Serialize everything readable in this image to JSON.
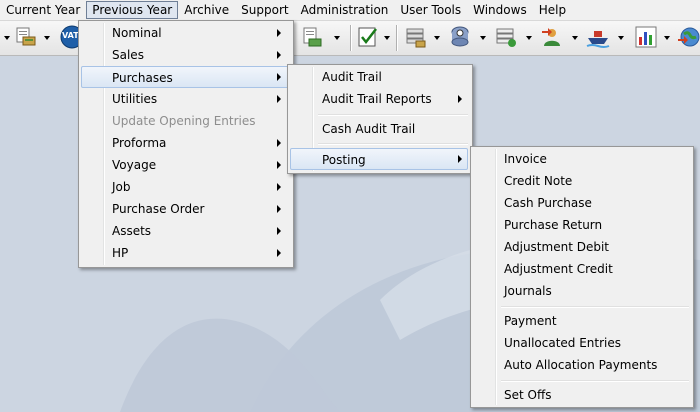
{
  "menubar": {
    "items": [
      "Current Year",
      "Previous Year",
      "Archive",
      "Support",
      "Administration",
      "User Tools",
      "Windows",
      "Help"
    ],
    "active_index": 1
  },
  "toolbar": {
    "vat_label": "VAT",
    "icons": [
      "page-icon",
      "reports-icon",
      "vat-icon",
      "stack-icon",
      "invoice-icon",
      "checkmark-icon",
      "drawer-icon",
      "database-icon",
      "layers-icon",
      "users-icon",
      "ship-icon",
      "chart-icon",
      "globe-icon"
    ]
  },
  "menu_level1": {
    "items": [
      {
        "label": "Nominal",
        "submenu": true,
        "disabled": false
      },
      {
        "label": "Sales",
        "submenu": true,
        "disabled": false
      },
      {
        "label": "Purchases",
        "submenu": true,
        "disabled": false,
        "highlighted": true
      },
      {
        "label": "Utilities",
        "submenu": true,
        "disabled": false
      },
      {
        "label": "Update Opening Entries",
        "submenu": false,
        "disabled": true
      },
      {
        "label": "Proforma",
        "submenu": true,
        "disabled": false
      },
      {
        "label": "Voyage",
        "submenu": true,
        "disabled": false
      },
      {
        "label": "Job",
        "submenu": true,
        "disabled": false
      },
      {
        "label": "Purchase Order",
        "submenu": true,
        "disabled": false
      },
      {
        "label": "Assets",
        "submenu": true,
        "disabled": false
      },
      {
        "label": "HP",
        "submenu": true,
        "disabled": false
      }
    ]
  },
  "menu_level2": {
    "items": [
      {
        "label": "Audit Trail",
        "submenu": false
      },
      {
        "label": "Audit Trail Reports",
        "submenu": true
      },
      {
        "label": "Cash Audit Trail",
        "submenu": false
      },
      {
        "label": "Posting",
        "submenu": true,
        "highlighted": true
      }
    ]
  },
  "menu_level3": {
    "items": [
      {
        "label": "Invoice"
      },
      {
        "label": "Credit Note"
      },
      {
        "label": "Cash Purchase"
      },
      {
        "label": "Purchase Return"
      },
      {
        "label": "Adjustment Debit"
      },
      {
        "label": "Adjustment Credit"
      },
      {
        "label": "Journals"
      },
      {
        "label": "Payment"
      },
      {
        "label": "Unallocated Entries"
      },
      {
        "label": "Auto Allocation Payments"
      },
      {
        "label": "Set Offs"
      }
    ]
  },
  "colors": {
    "background": "#ccd5e1",
    "menu_bg": "#f0f0f0",
    "highlight_border": "#a8c3e6",
    "disabled_text": "#8d8d8d"
  }
}
